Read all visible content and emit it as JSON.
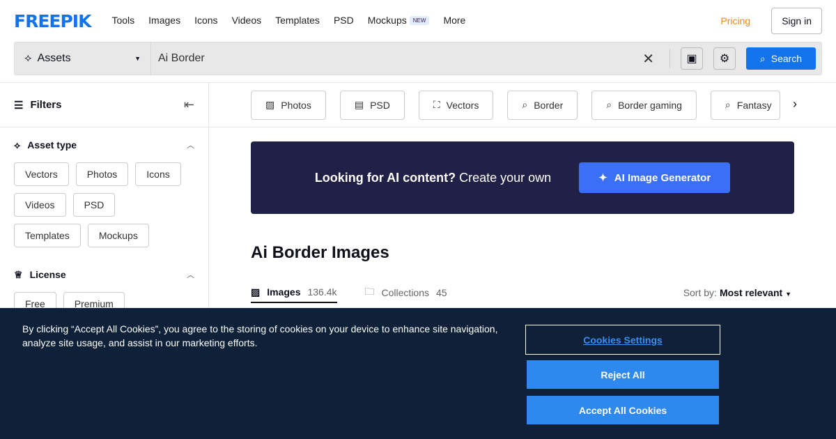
{
  "header": {
    "logo": "FREEPIK",
    "nav": [
      "Tools",
      "Images",
      "Icons",
      "Videos",
      "Templates",
      "PSD",
      "Mockups",
      "More"
    ],
    "new_badge": "NEW",
    "pricing": "Pricing",
    "sign_in": "Sign in"
  },
  "search": {
    "asset_type": "Assets",
    "query": "Ai Border",
    "button": "Search"
  },
  "filters": {
    "title": "Filters",
    "asset_type": {
      "title": "Asset type",
      "options": [
        "Vectors",
        "Photos",
        "Icons",
        "Videos",
        "PSD",
        "Templates",
        "Mockups"
      ]
    },
    "license": {
      "title": "License",
      "options": [
        "Free",
        "Premium"
      ]
    }
  },
  "tags": [
    "Photos",
    "PSD",
    "Vectors",
    "Border",
    "Border gaming",
    "Fantasy"
  ],
  "banner": {
    "bold": "Looking for AI content?",
    "text": " Create your own",
    "button": "AI Image Generator"
  },
  "title": "Ai Border Images",
  "tabs": [
    {
      "label": "Images",
      "count": "136.4k"
    },
    {
      "label": "Collections",
      "count": "45"
    }
  ],
  "sort": {
    "label": "Sort by:",
    "value": "Most relevant"
  },
  "cookie": {
    "text": "By clicking “Accept All Cookies”, you agree to the storing of cookies on your device to enhance site navigation, analyze site usage, and assist in our marketing efforts.",
    "settings": "Cookies Settings",
    "reject": "Reject All",
    "accept": "Accept All Cookies"
  }
}
